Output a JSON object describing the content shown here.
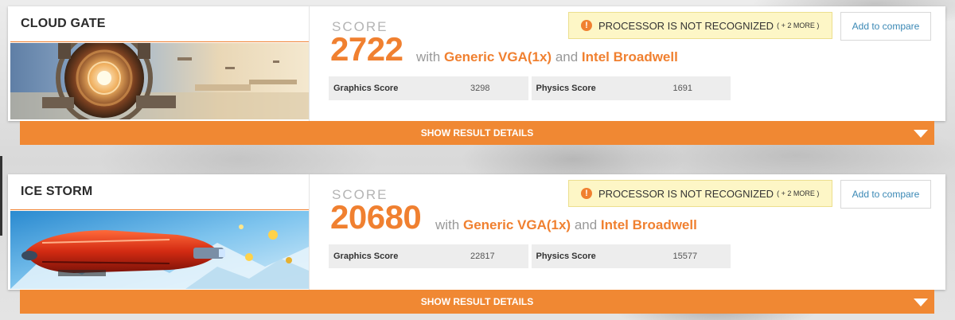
{
  "colors": {
    "accent": "#f08030",
    "link": "#3a88b5",
    "warning_bg": "#fdf6c6"
  },
  "results": [
    {
      "test_name": "CLOUD GATE",
      "score_label": "SCORE",
      "score": "2722",
      "with_text": "with",
      "gpu": "Generic VGA(1x)",
      "and_text": "and",
      "cpu": "Intel Broadwell",
      "subscores": [
        {
          "name": "Graphics Score",
          "value": "3298"
        },
        {
          "name": "Physics Score",
          "value": "1691"
        }
      ],
      "warning": {
        "icon": "exclamation-icon",
        "text": "PROCESSOR IS NOT RECOGNIZED",
        "more": "( + 2 MORE )"
      },
      "compare_label": "Add to compare",
      "details_label": "SHOW RESULT DETAILS"
    },
    {
      "test_name": "ICE STORM",
      "score_label": "SCORE",
      "score": "20680",
      "with_text": "with",
      "gpu": "Generic VGA(1x)",
      "and_text": "and",
      "cpu": "Intel Broadwell",
      "subscores": [
        {
          "name": "Graphics Score",
          "value": "22817"
        },
        {
          "name": "Physics Score",
          "value": "15577"
        }
      ],
      "warning": {
        "icon": "exclamation-icon",
        "text": "PROCESSOR IS NOT RECOGNIZED",
        "more": "( + 2 MORE )"
      },
      "compare_label": "Add to compare",
      "details_label": "SHOW RESULT DETAILS"
    }
  ]
}
